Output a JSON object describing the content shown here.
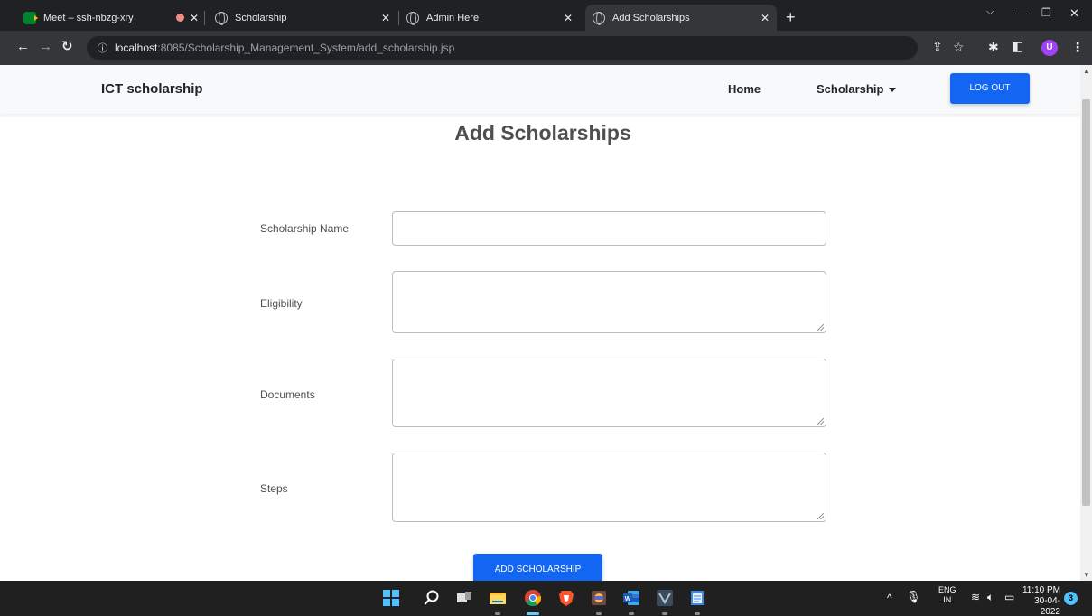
{
  "browser": {
    "tabs": [
      {
        "title": "Meet – ssh-nbzg-xry",
        "icon": "meet-icon",
        "recording": true
      },
      {
        "title": "Scholarship",
        "icon": "globe-icon"
      },
      {
        "title": "Admin Here",
        "icon": "globe-icon"
      },
      {
        "title": "Add Scholarships",
        "icon": "globe-icon",
        "active": true
      }
    ],
    "url_host": "localhost",
    "url_rest": ":8085/Scholarship_Management_System/add_scholarship.jsp",
    "profile_initial": "U"
  },
  "navbar": {
    "brand": "ICT scholarship",
    "home": "Home",
    "scholarship": "Scholarship",
    "logout": "LOG OUT"
  },
  "page": {
    "title": "Add Scholarships",
    "fields": [
      {
        "label": "Scholarship Name",
        "type": "input",
        "value": ""
      },
      {
        "label": "Eligibility",
        "type": "textarea",
        "value": ""
      },
      {
        "label": "Documents",
        "type": "textarea",
        "value": ""
      },
      {
        "label": "Steps",
        "type": "textarea",
        "value": ""
      }
    ],
    "submit": "ADD SCHOLARSHIP"
  },
  "taskbar": {
    "language_line1": "ENG",
    "language_line2": "IN",
    "time": "11:10 PM",
    "date": "30-04-2022",
    "notifications": "3"
  },
  "colors": {
    "primary": "#1266f1",
    "tabbar": "#202124",
    "toolbar": "#35363a",
    "taskbar": "#202020"
  }
}
